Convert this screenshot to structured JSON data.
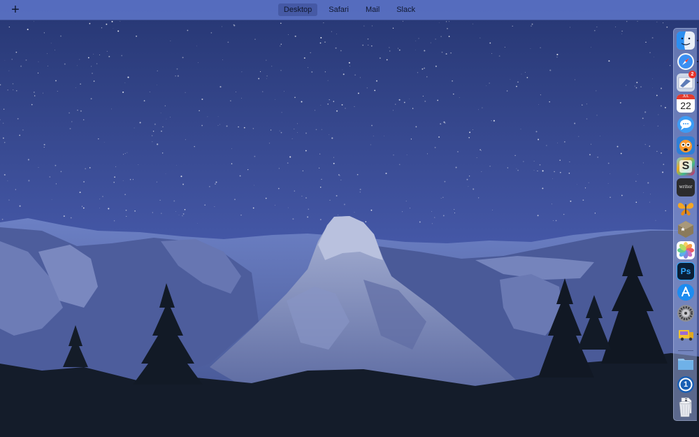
{
  "topbar": {
    "add_space_glyph": "+",
    "spaces": [
      {
        "label": "Desktop",
        "active": true
      },
      {
        "label": "Safari",
        "active": false
      },
      {
        "label": "Mail",
        "active": false
      },
      {
        "label": "Slack",
        "active": false
      }
    ]
  },
  "dock": {
    "items": [
      {
        "icon": "finder-icon",
        "running": true
      },
      {
        "icon": "safari-icon",
        "running": true
      },
      {
        "icon": "mail-icon",
        "running": true,
        "badge": "2"
      },
      {
        "icon": "calendar-icon",
        "running": false,
        "month": "JUL",
        "day": "22"
      },
      {
        "icon": "messages-icon",
        "running": false
      },
      {
        "icon": "tweetbot-icon",
        "running": true
      },
      {
        "icon": "slack-icon",
        "running": true,
        "glyph": "S"
      },
      {
        "icon": "writer-icon",
        "running": false,
        "glyph": "writer"
      },
      {
        "icon": "butterfly-icon",
        "running": false
      },
      {
        "icon": "reeder-icon",
        "running": false
      },
      {
        "icon": "photos-icon",
        "running": false
      },
      {
        "icon": "photoshop-icon",
        "running": false,
        "glyph": "Ps"
      },
      {
        "icon": "app-store-icon",
        "running": false
      },
      {
        "icon": "system-preferences-icon",
        "running": false
      },
      {
        "icon": "transmit-icon",
        "running": true
      },
      {
        "icon": "downloads-folder-icon",
        "running": false
      },
      {
        "icon": "onepassword-icon",
        "running": false,
        "glyph": "1"
      },
      {
        "icon": "archive-icon",
        "running": false
      },
      {
        "icon": "trash-icon",
        "running": false
      }
    ]
  },
  "colors": {
    "topbar_bg": "#5c74c8",
    "sky_top": "#243570",
    "sky_bottom": "#6e86d4",
    "badge": "#e8342c"
  }
}
